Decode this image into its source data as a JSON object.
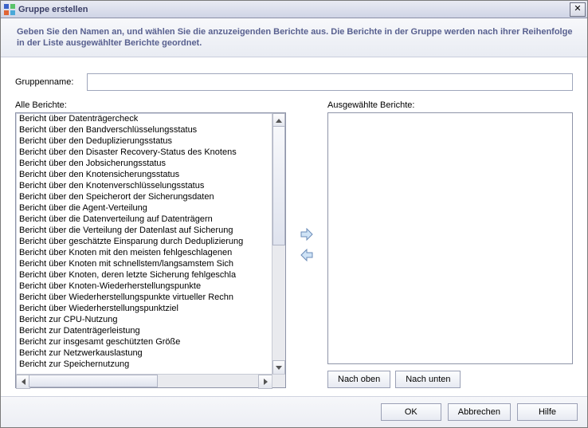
{
  "window": {
    "title": "Gruppe erstellen",
    "description": "Geben Sie den Namen an, und wählen Sie die anzuzeigenden Berichte aus. Die Berichte in der Gruppe werden nach ihrer Reihenfolge in der Liste ausgewählter Berichte geordnet."
  },
  "form": {
    "group_name_label": "Gruppenname:",
    "group_name_value": ""
  },
  "left_list": {
    "label": "Alle Berichte:",
    "items": [
      "Bericht über Datenträgercheck",
      "Bericht über den Bandverschlüsselungsstatus",
      "Bericht über den Deduplizierungsstatus",
      "Bericht über den Disaster Recovery-Status des Knotens",
      "Bericht über den Jobsicherungsstatus",
      "Bericht über den Knotensicherungsstatus",
      "Bericht über den Knotenverschlüsselungsstatus",
      "Bericht über den Speicherort der Sicherungsdaten",
      "Bericht über die Agent-Verteilung",
      "Bericht über die Datenverteilung auf Datenträgern",
      "Bericht über die Verteilung der Datenlast auf Sicherung",
      "Bericht über geschätzte Einsparung durch Deduplizierung",
      "Bericht über Knoten mit den meisten fehlgeschlagenen",
      "Bericht über Knoten mit schnellstem/langsamstem Sich",
      "Bericht über Knoten, deren letzte Sicherung fehlgeschla",
      "Bericht über Knoten-Wiederherstellungspunkte",
      "Bericht über Wiederherstellungspunkte virtueller Rechn",
      "Bericht über Wiederherstellungspunktziel",
      "Bericht zur CPU-Nutzung",
      "Bericht zur Datenträgerleistung",
      "Bericht zur insgesamt geschützten Größe",
      "Bericht zur Netzwerkauslastung",
      "Bericht zur Speichernutzung"
    ]
  },
  "right_list": {
    "label": "Ausgewählte Berichte:"
  },
  "buttons": {
    "move_up": "Nach oben",
    "move_down": "Nach unten",
    "ok": "OK",
    "cancel": "Abbrechen",
    "help": "Hilfe"
  }
}
